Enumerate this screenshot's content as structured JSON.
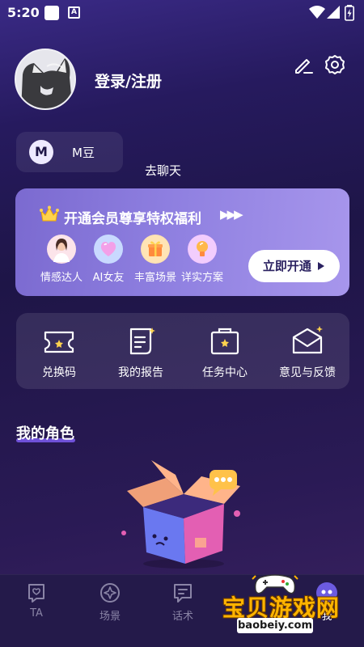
{
  "status_bar": {
    "time": "5:20",
    "notification_icon": "A"
  },
  "profile": {
    "login_text": "登录/注册"
  },
  "coins": {
    "badge": "M",
    "label": "M豆"
  },
  "go_chat": "去聊天",
  "vip": {
    "title": "开通会员尊享特权福利",
    "arrows": "▶▶▶",
    "perks": [
      {
        "label": "情感达人",
        "icon": "expert-avatar-icon"
      },
      {
        "label": "AI女友",
        "icon": "heart-icon"
      },
      {
        "label": "丰富场景",
        "icon": "gift-icon"
      },
      {
        "label": "详实方案",
        "icon": "bulb-icon"
      }
    ],
    "open_button": "立即开通"
  },
  "tools": [
    {
      "label": "兑换码",
      "icon": "ticket-icon"
    },
    {
      "label": "我的报告",
      "icon": "report-icon"
    },
    {
      "label": "任务中心",
      "icon": "task-icon"
    },
    {
      "label": "意见与反馈",
      "icon": "mail-icon"
    }
  ],
  "section": {
    "title": "我的角色"
  },
  "tabbar": [
    {
      "label": "TA",
      "icon": "chat-heart-icon"
    },
    {
      "label": "场景",
      "icon": "scene-icon"
    },
    {
      "label": "话术",
      "icon": "script-icon"
    },
    {
      "label": "我",
      "icon": "profile-icon"
    }
  ],
  "watermark": {
    "title": "宝贝游戏网",
    "url": "baobeiy.com"
  },
  "colors": {
    "accent": "#7c5cf0",
    "vip_card": "#8e7fe0",
    "background": "#1e1547"
  }
}
